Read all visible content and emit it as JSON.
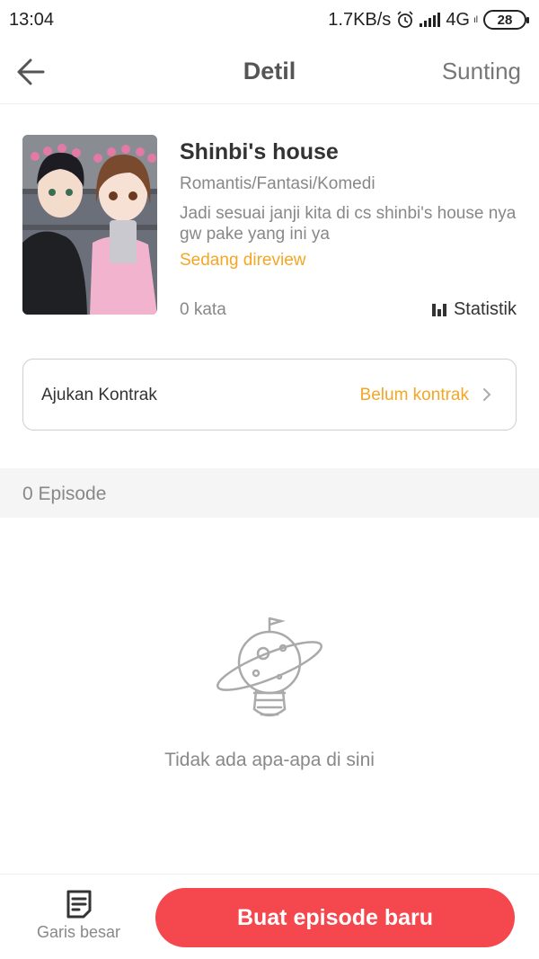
{
  "status_bar": {
    "time": "13:04",
    "speed": "1.7KB/s",
    "network": "4G",
    "network_tag": "ıl",
    "battery": "28",
    "icons": [
      "alarm-icon",
      "signal-icon",
      "battery-icon"
    ]
  },
  "header": {
    "back_icon": "arrow-left-icon",
    "title": "Detil",
    "edit_label": "Sunting"
  },
  "book": {
    "title": "Shinbi's house",
    "genre": "Romantis/Fantasi/Komedi",
    "description": "Jadi sesuai janji kita di cs shinbi's house nya gw pake yang ini ya",
    "status": "Sedang direview",
    "word_count": "0 kata",
    "stats_label": "Statistik"
  },
  "contract": {
    "label": "Ajukan Kontrak",
    "status": "Belum kontrak"
  },
  "episodes": {
    "count_label": "0 Episode",
    "empty_text": "Tidak ada apa-apa di sini"
  },
  "bottom_bar": {
    "outline_label": "Garis besar",
    "create_label": "Buat episode baru"
  },
  "colors": {
    "accent_orange": "#f5a623",
    "primary_red": "#f4484e",
    "section_bg": "#f5f5f5"
  }
}
